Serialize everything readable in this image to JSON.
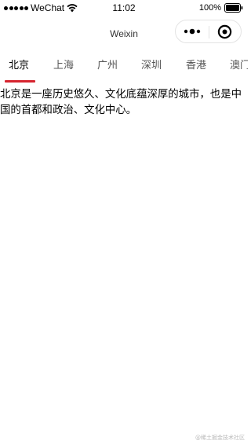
{
  "status_bar": {
    "carrier": "WeChat",
    "time": "11:02",
    "battery": "100%"
  },
  "nav": {
    "title": "Weixin"
  },
  "tabs": [
    {
      "label": "北京",
      "active": true
    },
    {
      "label": "上海",
      "active": false
    },
    {
      "label": "广州",
      "active": false
    },
    {
      "label": "深圳",
      "active": false
    },
    {
      "label": "香港",
      "active": false
    },
    {
      "label": "澳门",
      "active": false
    }
  ],
  "content": {
    "text": "北京是一座历史悠久、文化底蕴深厚的城市，也是中国的首都和政治、文化中心。"
  },
  "watermark": "@稀土掘金技术社区",
  "colors": {
    "accent": "#d6242f"
  }
}
